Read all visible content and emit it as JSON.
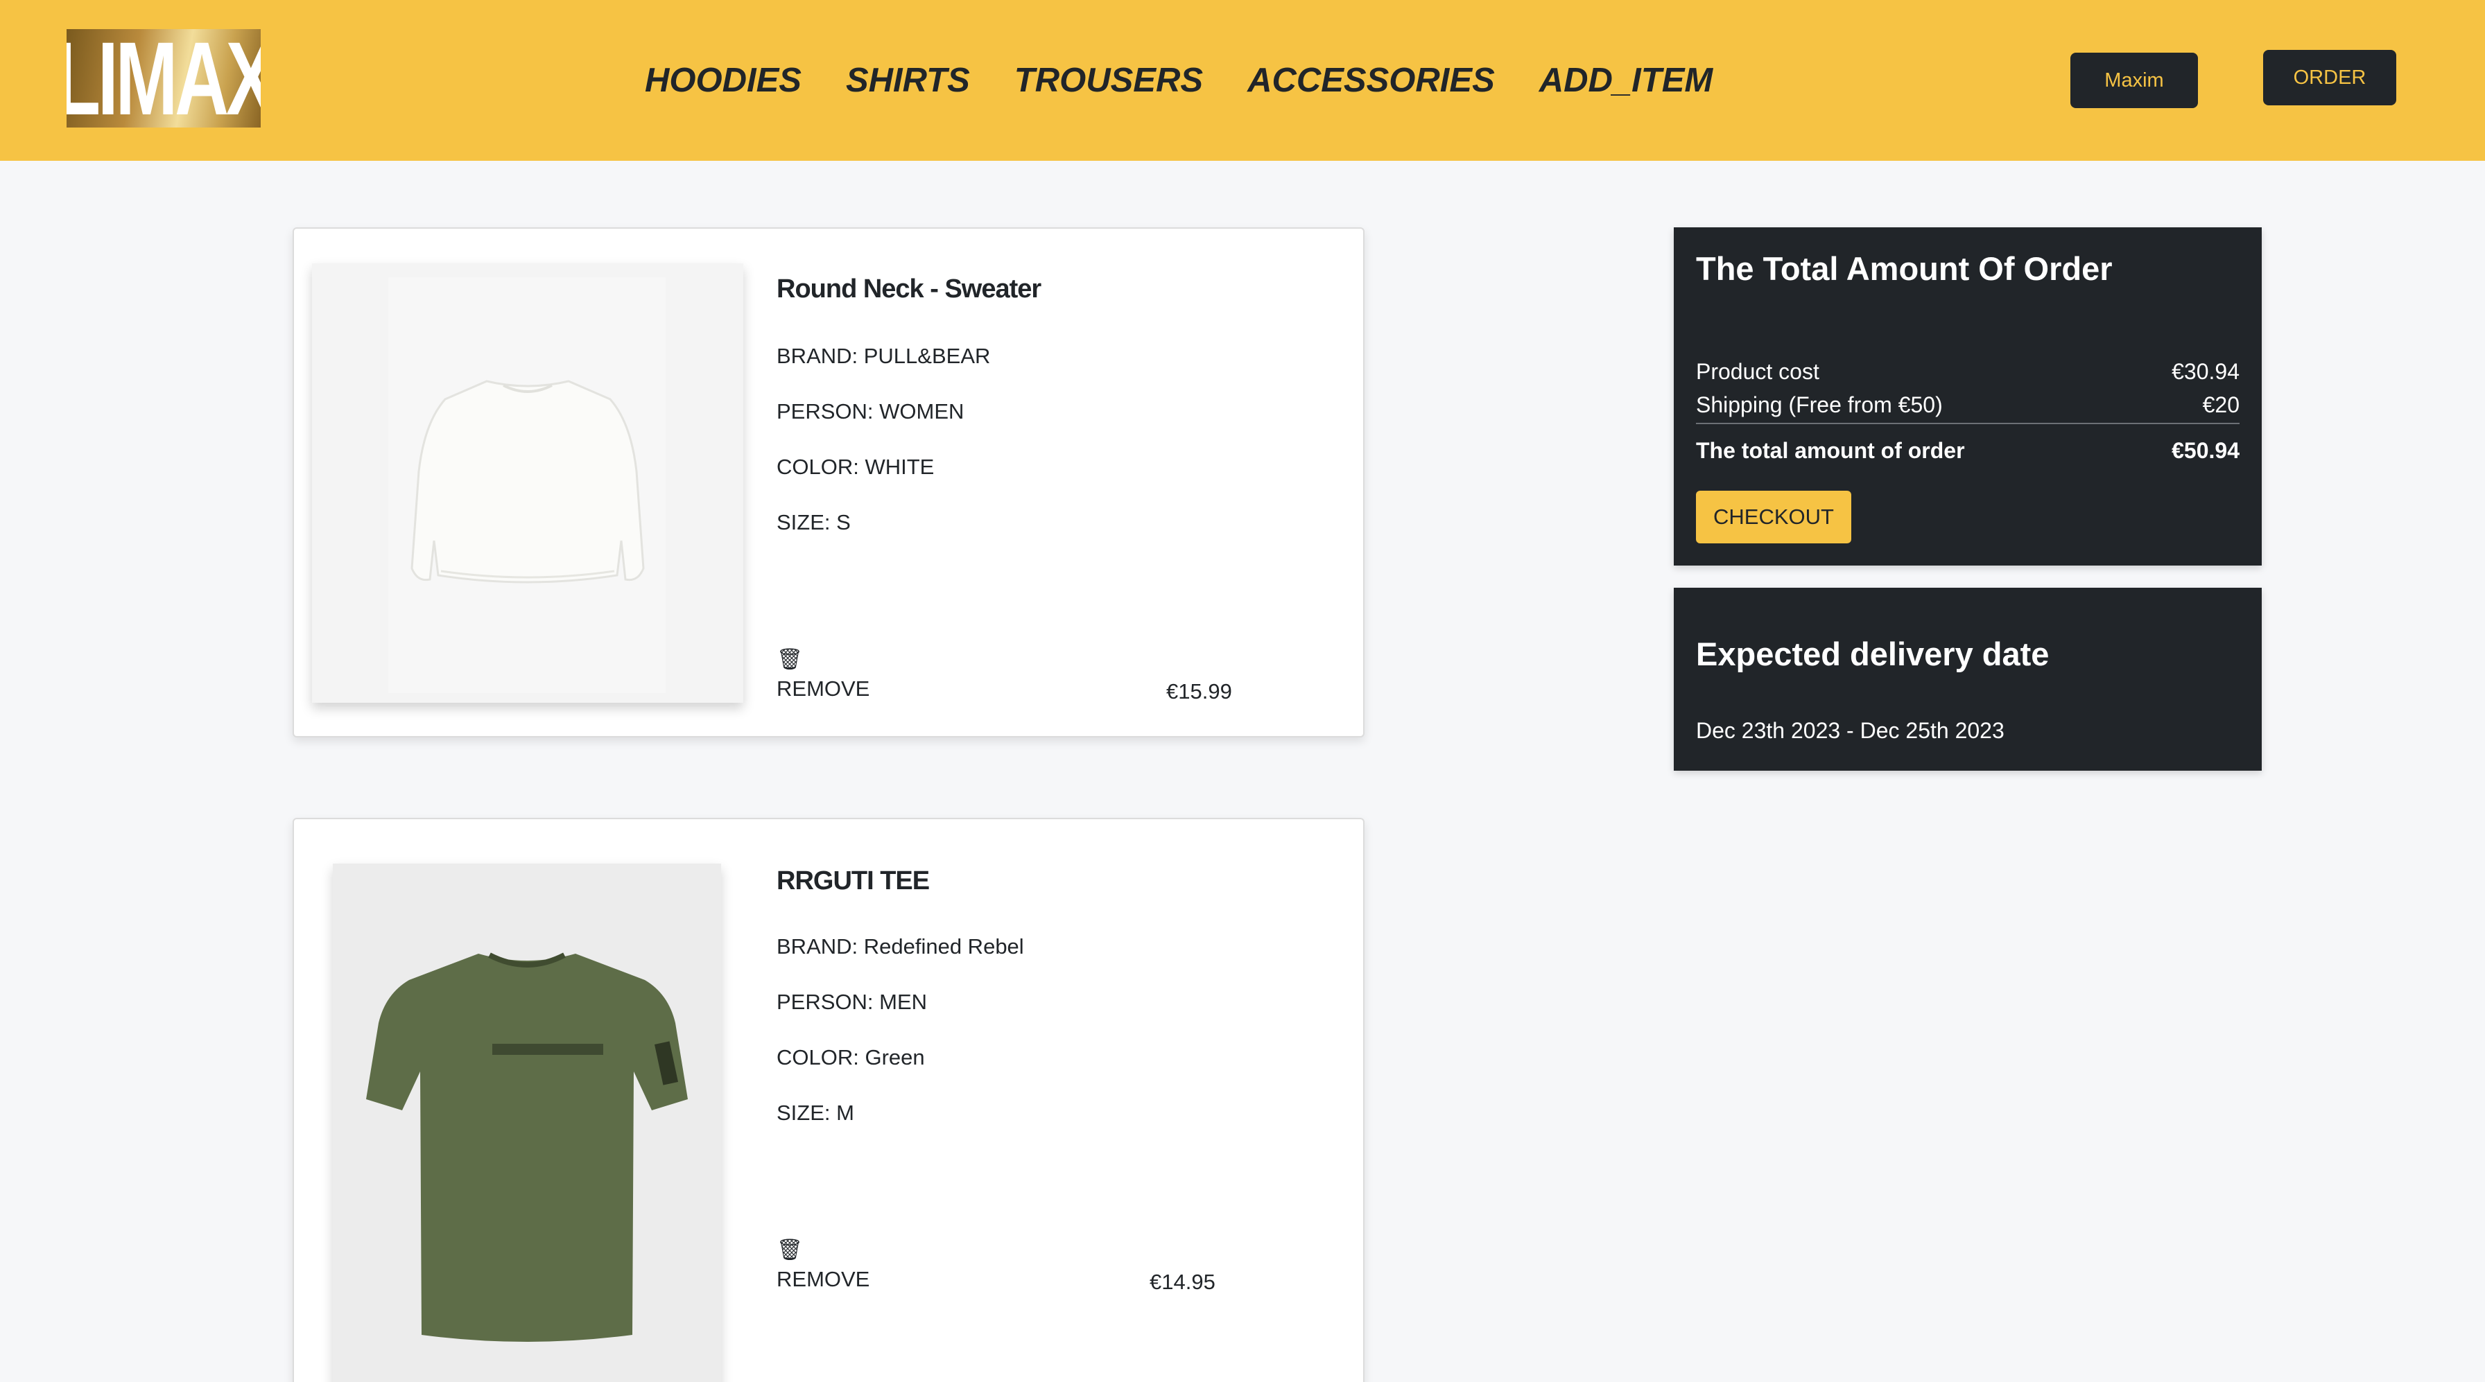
{
  "brand": {
    "logo_text": "LIMAX"
  },
  "nav": {
    "links": [
      "HOODIES",
      "SHIRTS",
      "TROUSERS",
      "ACCESSORIES",
      "ADD_ITEM"
    ],
    "user_label": "Maxim",
    "order_label": "ORDER"
  },
  "cart": {
    "items": [
      {
        "title": "Round Neck - Sweater",
        "brand": "BRAND: PULL&BEAR",
        "person": "PERSON: WOMEN",
        "color": "COLOR: WHITE",
        "size": "SIZE: S",
        "trash_icon": "🗑",
        "remove_label": "REMOVE",
        "price": "€15.99"
      },
      {
        "title": "RRGUTI TEE",
        "brand": "BRAND: Redefined Rebel",
        "person": "PERSON: MEN",
        "color": "COLOR: Green",
        "size": "SIZE: M",
        "trash_icon": "🗑",
        "remove_label": "REMOVE",
        "price": "€14.95"
      }
    ]
  },
  "summary": {
    "title": "The Total Amount Of Order",
    "product_cost_label": "Product cost",
    "product_cost_value": "€30.94",
    "shipping_label": "Shipping (Free from €50)",
    "shipping_value": "€20",
    "total_label": "The total amount of order",
    "total_value": "€50.94",
    "checkout_label": "CHECKOUT"
  },
  "delivery": {
    "title": "Expected delivery date",
    "range": "Dec 23th 2023 - Dec 25th 2023"
  },
  "colors": {
    "accent": "#f6c344",
    "dark": "#212529",
    "background": "#f6f7f9"
  }
}
